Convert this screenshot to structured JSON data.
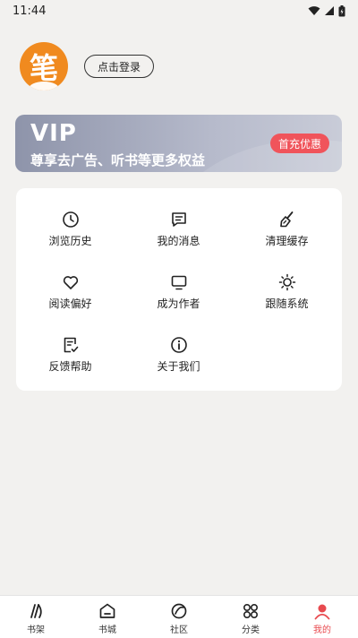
{
  "status_bar": {
    "time": "11:44"
  },
  "profile": {
    "avatar_char": "笔",
    "login_label": "点击登录"
  },
  "vip": {
    "title": "VIP",
    "subtitle": "尊享去广告、听书等更多权益",
    "offer": "首充优惠"
  },
  "menu": [
    {
      "label": "浏览历史",
      "icon": "clock-icon"
    },
    {
      "label": "我的消息",
      "icon": "message-icon"
    },
    {
      "label": "清理缓存",
      "icon": "broom-icon"
    },
    {
      "label": "阅读偏好",
      "icon": "heart-icon"
    },
    {
      "label": "成为作者",
      "icon": "monitor-icon"
    },
    {
      "label": "跟随系统",
      "icon": "sun-icon"
    },
    {
      "label": "反馈帮助",
      "icon": "feedback-icon"
    },
    {
      "label": "关于我们",
      "icon": "info-icon"
    }
  ],
  "nav": [
    {
      "label": "书架",
      "icon": "bookshelf-icon",
      "active": false
    },
    {
      "label": "书城",
      "icon": "bookstore-icon",
      "active": false
    },
    {
      "label": "社区",
      "icon": "community-icon",
      "active": false
    },
    {
      "label": "分类",
      "icon": "category-icon",
      "active": false
    },
    {
      "label": "我的",
      "icon": "profile-icon",
      "active": true
    }
  ],
  "colors": {
    "accent": "#e84a4f",
    "avatar_bg": "#f08a1f",
    "vip_offer": "#f0545b"
  }
}
